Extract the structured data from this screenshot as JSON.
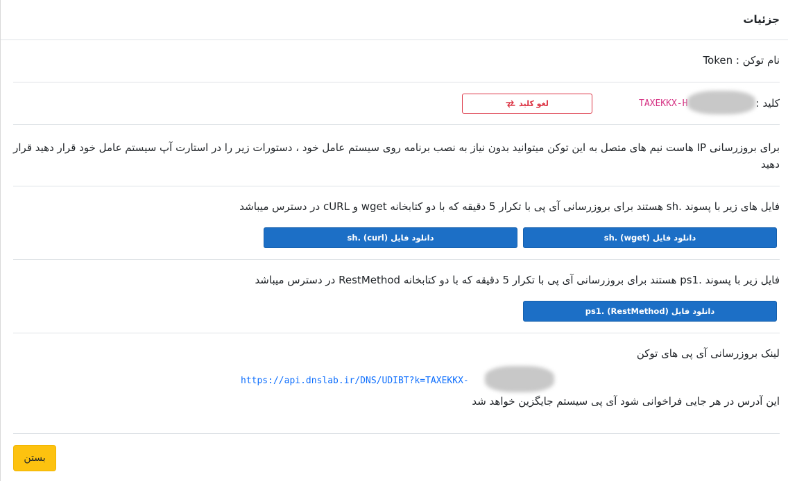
{
  "header": {
    "title": "جزئیات"
  },
  "token_name": {
    "label": "نام توکن : Token"
  },
  "key": {
    "label": "کلید :",
    "value": "TAXEKKX-H",
    "revoke_button": "لغو کلید",
    "revoke_icon": "swap-arrows-icon"
  },
  "intro": {
    "text": "برای بروزرسانی IP هاست نیم های متصل به این توکن میتوانید بدون نیاز به نصب برنامه روی سیستم عامل خود ، دستورات زیر را در استارت آپ سیستم عامل خود قرار دهید قرار دهید"
  },
  "sh_files": {
    "text": "فایل های زیر با پسوند .sh هستند برای بروزرسانی آی پی با تکرار 5 دقیقه که با دو کتابخانه wget و cURL در دسترس میباشد",
    "wget_button": "دانلود فایل (wget) .sh",
    "curl_button": "دانلود فایل (curl) .sh"
  },
  "ps1_file": {
    "text": "فایل زیر با پسوند .ps1 هستند برای بروزرسانی آی پی با تکرار 5 دقیقه که با دو کتابخانه RestMethod در دسترس میباشد",
    "restmethod_button": "دانلود فایل (RestMethod) .ps1"
  },
  "update_link": {
    "title": "لینک بروزرسانی آی پی های توکن",
    "url": "https://api.dnslab.ir/DNS/UDIBT?k=TAXEKKX-",
    "note": "این آدرس در هر جایی فراخوانی شود آی پی سیستم جایگزین خواهد شد"
  },
  "footer": {
    "close_button": "بستن"
  },
  "colors": {
    "primary": "#1c6fc6",
    "danger": "#dc3545",
    "warning": "#fdc20f",
    "key_text": "#d63384",
    "link_text": "#0d6efd"
  }
}
